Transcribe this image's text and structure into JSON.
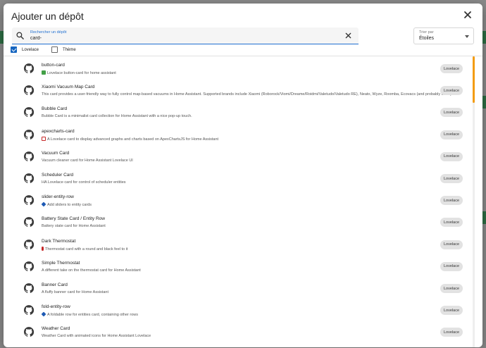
{
  "dialog": {
    "title": "Ajouter un dépôt"
  },
  "search": {
    "label": "Rechercher un dépôt",
    "value": "card-"
  },
  "sort": {
    "label": "Trier par",
    "value": "Étoiles"
  },
  "filters": [
    {
      "label": "Lovelace",
      "checked": true
    },
    {
      "label": "Thème",
      "checked": false
    }
  ],
  "repositories": [
    {
      "name": "button-card",
      "emoji": "green-square",
      "description": "Lovelace button-card for home assistant",
      "category": "Lovelace"
    },
    {
      "name": "Xiaomi Vacuum Map Card",
      "emoji": "",
      "description": "This card provides a user-friendly way to fully control map-based vacuums in Home Assistant. Supported brands include Xiaomi (Roborock/Viomi/Dreame/Roidmi/Valetudo/Valetudo RE), Neato, Wyze, Roomba, Ecovacs (and probably more).",
      "category": "Lovelace"
    },
    {
      "name": "Bubble Card",
      "emoji": "",
      "description": "Bubble Card is a minimalist card collection for Home Assistant with a nice pop-up touch.",
      "category": "Lovelace"
    },
    {
      "name": "apexcharts-card",
      "emoji": "chart",
      "description": "A Lovelace card to display advanced graphs and charts based on ApexChartsJS for Home Assistant",
      "category": "Lovelace"
    },
    {
      "name": "Vacuum Card",
      "emoji": "",
      "description": "Vacuum cleaner card for Home Assistant Lovelace UI",
      "category": "Lovelace"
    },
    {
      "name": "Scheduler Card",
      "emoji": "",
      "description": "HA Lovelace card for control of scheduler entities",
      "category": "Lovelace"
    },
    {
      "name": "slider-entity-row",
      "emoji": "blue-diamond",
      "description": "Add sliders to entity cards",
      "category": "Lovelace"
    },
    {
      "name": "Battery State Card / Entity Row",
      "emoji": "",
      "description": "Battery state card for Home Assistant",
      "category": "Lovelace"
    },
    {
      "name": "Dark Thermostat",
      "emoji": "thermometer",
      "description": "Thermostat card with a round and black feel to it",
      "category": "Lovelace"
    },
    {
      "name": "Simple Thermostat",
      "emoji": "",
      "description": "A different take on the thermostat card for Home Assistant",
      "category": "Lovelace"
    },
    {
      "name": "Banner Card",
      "emoji": "",
      "description": "A fluffy banner card for Home Assistant",
      "category": "Lovelace"
    },
    {
      "name": "fold-entity-row",
      "emoji": "blue-diamond",
      "description": "A foldable row for entities card, containing other rows",
      "category": "Lovelace"
    },
    {
      "name": "Weather Card",
      "emoji": "",
      "description": "Weather Card with animated icons for Home Assistant Lovelace",
      "category": "Lovelace"
    }
  ],
  "colors": {
    "accent": "#1565c0",
    "scroll_thumb": "#f39c12"
  }
}
